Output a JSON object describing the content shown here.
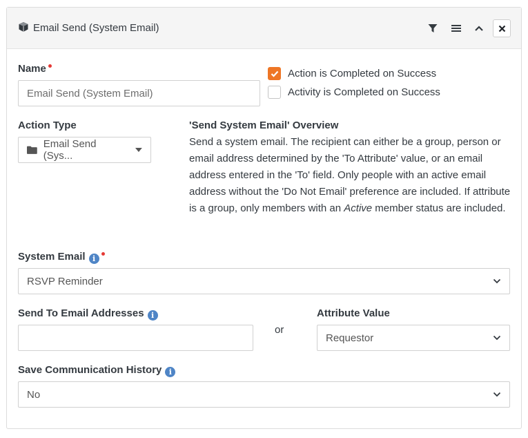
{
  "header": {
    "title": "Email Send (System Email)",
    "icons": [
      "cube-icon",
      "filter-icon",
      "menu-icon",
      "chevron-up-icon",
      "close-icon"
    ]
  },
  "name": {
    "label": "Name",
    "value": "Email Send (System Email)"
  },
  "checks": {
    "action_completed": {
      "label": "Action is Completed on Success",
      "checked": true
    },
    "activity_completed": {
      "label": "Activity is Completed on Success",
      "checked": false
    }
  },
  "action_type": {
    "label": "Action Type",
    "value": "Email Send (Sys..."
  },
  "overview": {
    "title": "'Send System Email' Overview",
    "text_before": "Send a system email. The recipient can either be a group, person or email address determined by the 'To Attribute' value, or an email address entered in the 'To' field. Only people with an active email address without the 'Do Not Email' preference are included. If attribute is a group, only members with an ",
    "emphasis": "Active",
    "text_after": " member status are included."
  },
  "system_email": {
    "label": "System Email",
    "value": "RSVP Reminder"
  },
  "send_to": {
    "label": "Send To Email Addresses",
    "value": ""
  },
  "or_label": "or",
  "attribute_value": {
    "label": "Attribute Value",
    "value": "Requestor"
  },
  "save_history": {
    "label": "Save Communication History",
    "value": "No"
  },
  "colors": {
    "accent": "#ee7625",
    "required": "#e53935",
    "info": "#4f85c6"
  }
}
